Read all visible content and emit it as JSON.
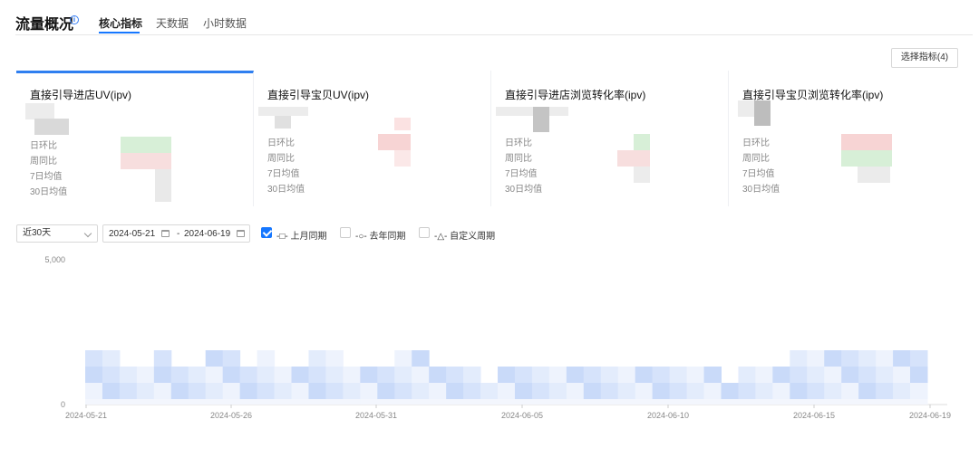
{
  "header": {
    "title": "流量概况",
    "info_icon": "i",
    "tabs": [
      {
        "label": "核心指标",
        "active": true
      },
      {
        "label": "天数据",
        "active": false
      },
      {
        "label": "小时数据",
        "active": false
      }
    ]
  },
  "select_metrics_button": "选择指标(4)",
  "cards": [
    {
      "title": "直接引导进店UV(ipv)",
      "rows": [
        "日环比",
        "周同比",
        "7日均值",
        "30日均值"
      ]
    },
    {
      "title": "直接引导宝贝UV(ipv)",
      "rows": [
        "日环比",
        "周同比",
        "7日均值",
        "30日均值"
      ]
    },
    {
      "title": "直接引导进店浏览转化率(ipv)",
      "rows": [
        "日环比",
        "周同比",
        "7日均值",
        "30日均值"
      ]
    },
    {
      "title": "直接引导宝贝浏览转化率(ipv)",
      "rows": [
        "日环比",
        "周同比",
        "7日均值",
        "30日均值"
      ]
    }
  ],
  "controls": {
    "range_select": "近30天",
    "date_start": "2024-05-21",
    "date_sep": "-",
    "date_end": "2024-06-19",
    "compare_options": [
      {
        "label": "-□- 上月同期",
        "checked": true
      },
      {
        "label": "-○- 去年同期",
        "checked": false
      },
      {
        "label": "-△- 自定义周期",
        "checked": false
      }
    ]
  },
  "colors": {
    "accent": "#1677ff",
    "active_card": "#2f7ff0",
    "up": "#f7d4d4",
    "down": "#d7efd7"
  },
  "chart_data": {
    "type": "area",
    "x_ticks": [
      "2024-05-21",
      "2024-05-26",
      "2024-05-31",
      "2024-06-05",
      "2024-06-10",
      "2024-06-15",
      "2024-06-19"
    ],
    "y_ticks": [
      "5,000",
      "0"
    ],
    "ylim": [
      0,
      5000
    ]
  }
}
